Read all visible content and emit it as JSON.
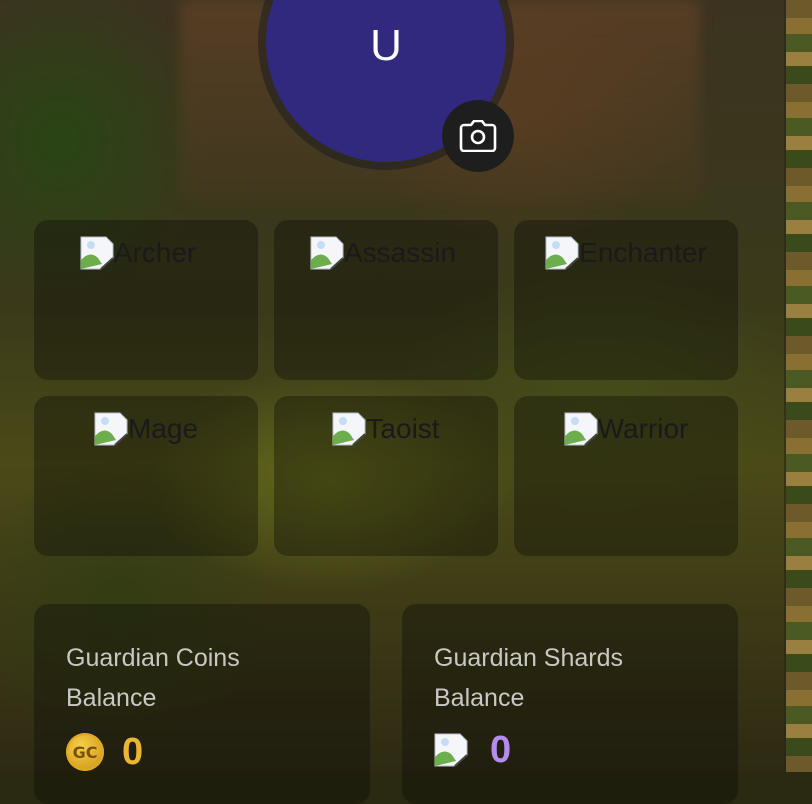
{
  "profile": {
    "avatar_letter": "U",
    "avatar_color": "#30297e",
    "camera_icon": "camera-icon"
  },
  "classes": [
    {
      "label": "Archer"
    },
    {
      "label": "Assassin"
    },
    {
      "label": "Enchanter"
    },
    {
      "label": "Mage"
    },
    {
      "label": "Taoist"
    },
    {
      "label": "Warrior"
    }
  ],
  "balances": {
    "coins": {
      "title": "Guardian Coins Balance",
      "icon_text": "GC",
      "value": "0",
      "color": "#e9b730"
    },
    "shards": {
      "title": "Guardian Shards Balance",
      "value": "0",
      "color": "#b48cf0"
    }
  }
}
